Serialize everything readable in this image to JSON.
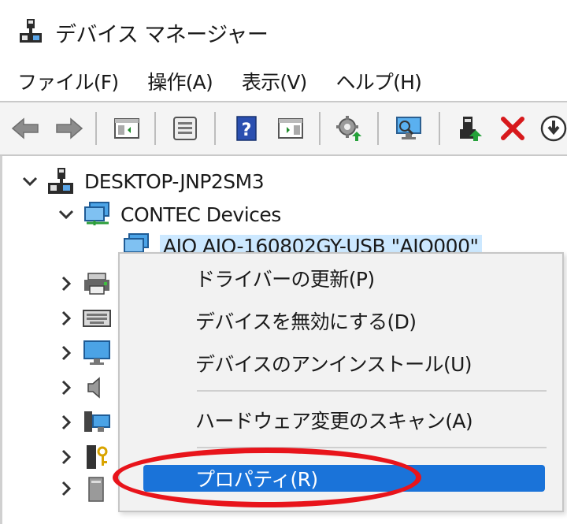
{
  "window": {
    "title": "デバイス マネージャー"
  },
  "menubar": {
    "items": [
      "ファイル(F)",
      "操作(A)",
      "表示(V)",
      "ヘルプ(H)"
    ]
  },
  "toolbar": {
    "buttons": [
      {
        "name": "back-arrow-icon"
      },
      {
        "name": "forward-arrow-icon"
      },
      {
        "name": "show-hide-console-tree-icon"
      },
      {
        "name": "properties-icon"
      },
      {
        "name": "help-icon"
      },
      {
        "name": "show-action-pane-icon"
      },
      {
        "name": "update-driver-icon"
      },
      {
        "name": "scan-hardware-changes-icon"
      },
      {
        "name": "enable-device-icon"
      },
      {
        "name": "uninstall-device-icon"
      },
      {
        "name": "download-driver-icon"
      }
    ]
  },
  "tree": {
    "root": {
      "label": "DESKTOP-JNP2SM3"
    },
    "category": {
      "label": "CONTEC Devices"
    },
    "device": {
      "label": "AIO AIO-160802GY-USB \"AIO000\""
    },
    "collapsed_nodes": [
      {
        "icon": "printer-icon"
      },
      {
        "icon": "keyboard-icon"
      },
      {
        "icon": "monitor-icon"
      },
      {
        "icon": "speaker-icon"
      },
      {
        "icon": "network-computer-icon"
      },
      {
        "icon": "security-device-icon"
      },
      {
        "icon": "storage-icon"
      }
    ]
  },
  "context_menu": {
    "items": [
      "ドライバーの更新(P)",
      "デバイスを無効にする(D)",
      "デバイスのアンインストール(U)",
      "ハードウェア変更のスキャン(A)",
      "プロパティ(R)"
    ]
  },
  "colors": {
    "highlight": "#1a73d9",
    "callout": "#e8141b",
    "selection": "#cce8ff"
  }
}
